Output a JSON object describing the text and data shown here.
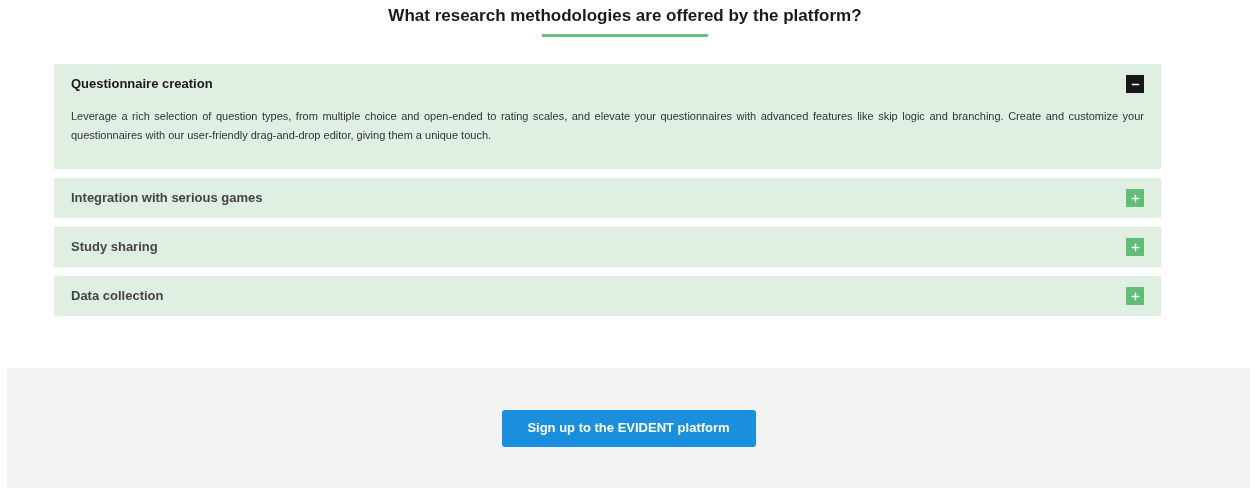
{
  "heading": "What research methodologies are offered by the platform?",
  "accordion": [
    {
      "title": "Questionnaire creation",
      "expanded": true,
      "body": "Leverage a rich selection of question types, from multiple choice and open-ended to rating scales, and elevate your questionnaires with advanced features like skip logic and branching. Create and customize your questionnaires with our user-friendly drag-and-drop editor, giving them a unique touch."
    },
    {
      "title": "Integration with serious games",
      "expanded": false
    },
    {
      "title": "Study sharing",
      "expanded": false
    },
    {
      "title": "Data collection",
      "expanded": false
    }
  ],
  "cta": {
    "label": "Sign up to the EVIDENT platform"
  }
}
